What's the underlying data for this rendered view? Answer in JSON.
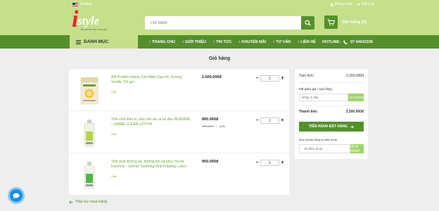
{
  "header": {
    "language": "English",
    "login": "Đăng nhập",
    "register": "Đăng ký",
    "logo_letter": "i",
    "logo_word": "style",
    "logo_tagline": "THE NUTRITION CONCEPT",
    "search_placeholder": "Tìm kiếm",
    "cart_label": "Giỏ hàng (3)"
  },
  "nav": {
    "menu_label": "DANH MỤC",
    "items": [
      "TRANG CHỦ",
      "GIỚI THIỆU",
      "TIN TỨC",
      "KHUYẾN MÃI",
      "TƯ VẤN",
      "LIÊN HỆ"
    ],
    "hotline_label": "HOTLINE:",
    "hotline_number": "07 04543336"
  },
  "page": {
    "title": "Giỏ hàng",
    "back_link": "Tiếp tục mua hàng"
  },
  "cart_items": [
    {
      "name": "Bột Protein Nature Zen Mầm Gạo lứt, Hương Vanilla 720 gm",
      "price": "1.500.000đ",
      "old_price": "",
      "discount": "",
      "quantity": "1",
      "remove": "Xóa"
    },
    {
      "name": "Tinh chất điều trị, dầu nền da và da dầu INDEMNE - GIMME CLEAN LOTION",
      "price": "800.000đ",
      "old_price": "900.000đ",
      "discount": "-11%",
      "quantity": "1",
      "remove": "Xóa"
    },
    {
      "name": "Tinh chất dưỡng da, dưỡng ẩm và phục hồi da Indemne - Gimme Soothing! Anti-Irritating Lotion",
      "price": "900.000đ",
      "old_price": "",
      "discount": "",
      "quantity": "1",
      "remove": "Xóa"
    }
  ],
  "summary": {
    "subtotal_label": "Tạm tính:",
    "subtotal": "3.200.000đ",
    "coupon_label": "Mã giảm giá / Quà tặng",
    "coupon_placeholder": "Nhập ở đây",
    "apply_label": "ÁP DỤNG",
    "total_label": "Thành tiền:",
    "total": "3.200.000đ",
    "checkout_label": "TIẾN HÀNH ĐẶT HÀNG",
    "quick_buy_label": "Mua nhanh bằng số điện thoại",
    "phone_placeholder": "Số điện thoại",
    "buy_now_label": "MUA NGAY"
  },
  "colors": {
    "header_bg": "#c5df8a",
    "nav_bg": "#558f2b",
    "accent_text": "#6ba834",
    "button_light": "#9fd36c",
    "logo_red": "#e8262d",
    "chat_blue": "#1a8fe0"
  }
}
